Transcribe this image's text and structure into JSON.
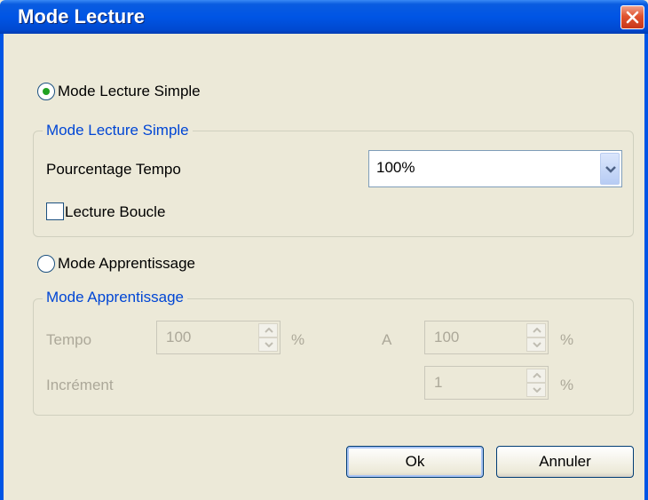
{
  "window": {
    "title": "Mode Lecture"
  },
  "simple": {
    "radio_label": "Mode Lecture Simple",
    "group_title": "Mode Lecture Simple",
    "tempo_label": "Pourcentage Tempo",
    "tempo_value": "100%",
    "loop_label": "Lecture Boucle",
    "selected": true,
    "loop_checked": false
  },
  "learning": {
    "radio_label": "Mode Apprentissage",
    "group_title": "Mode Apprentissage",
    "tempo_label": "Tempo",
    "tempo_from": "100",
    "percent1": "%",
    "a_label": "A",
    "tempo_to": "100",
    "percent2": "%",
    "increment_label": "Incrément",
    "increment_value": "1",
    "percent3": "%",
    "selected": false
  },
  "buttons": {
    "ok": "Ok",
    "cancel": "Annuler"
  },
  "colors": {
    "titlebar": "#0055e5",
    "accent_green": "#21a121",
    "group_title": "#0046d5",
    "disabled": "#aca899"
  }
}
